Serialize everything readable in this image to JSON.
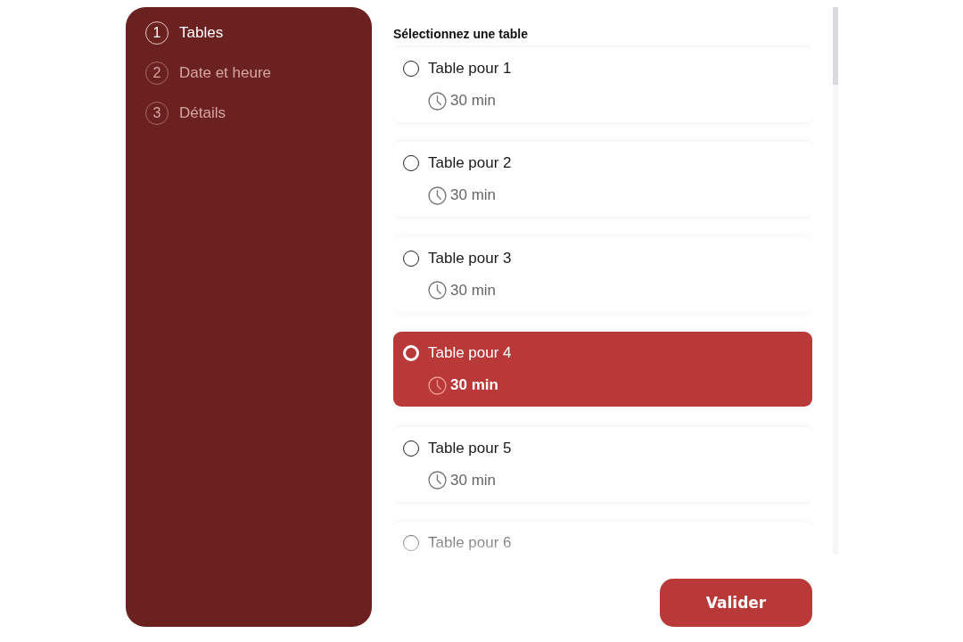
{
  "steps": [
    {
      "number": "1",
      "label": "Tables",
      "selected": true
    },
    {
      "number": "2",
      "label": "Date et heure",
      "selected": false
    },
    {
      "number": "3",
      "label": "Détails",
      "selected": false
    }
  ],
  "heading": "Sélectionnez une table",
  "tables": [
    {
      "label": "Table pour 1",
      "duration": "30 min",
      "selected": false
    },
    {
      "label": "Table pour 2",
      "duration": "30 min",
      "selected": false
    },
    {
      "label": "Table pour 3",
      "duration": "30 min",
      "selected": false
    },
    {
      "label": "Table pour 4",
      "duration": "30 min",
      "selected": true
    },
    {
      "label": "Table pour 5",
      "duration": "30 min",
      "selected": false
    },
    {
      "label": "Table pour 6",
      "selected": false
    }
  ],
  "submit_button": "Valider"
}
